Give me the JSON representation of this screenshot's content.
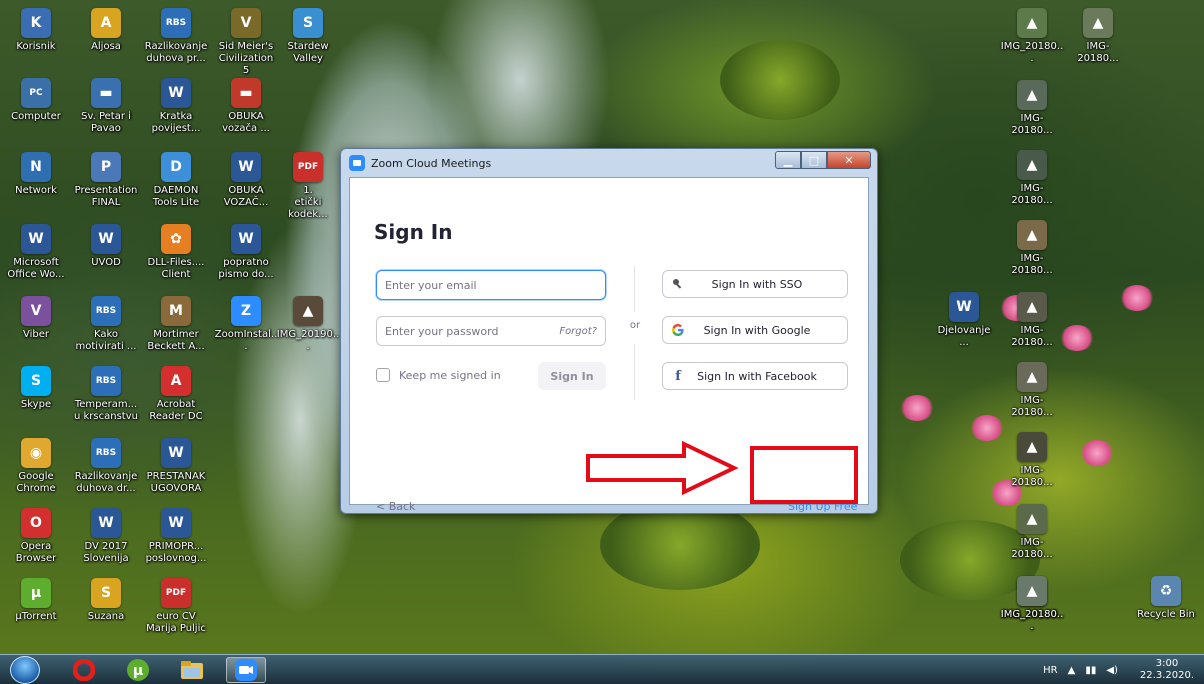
{
  "desktop": {
    "icons_left": [
      {
        "label": "Korisnik",
        "glyph": "K",
        "color": "#3b6db3"
      },
      {
        "label": "Aljosa",
        "glyph": "A",
        "color": "#d9a521"
      },
      {
        "label": "Razlikovanje\nduhova pr...",
        "glyph": "RBS",
        "color": "#2c6fb8"
      },
      {
        "label": "Sid Meier's\nCivilization 5",
        "glyph": "V",
        "color": "#7a6a2a"
      },
      {
        "label": "Stardew\nValley",
        "glyph": "S",
        "color": "#3a8fd0"
      },
      {
        "label": "Computer",
        "glyph": "PC",
        "color": "#3a6fa8"
      },
      {
        "label": "Sv. Petar i\nPavao",
        "glyph": "▬",
        "color": "#3a70b0"
      },
      {
        "label": "Kratka\npovijest...",
        "glyph": "W",
        "color": "#2b5797"
      },
      {
        "label": "OBUKA\nvozača ...",
        "glyph": "▬",
        "color": "#c0392b"
      },
      {
        "label": "Network",
        "glyph": "N",
        "color": "#2f6fb0"
      },
      {
        "label": "Presentation\nFINAL",
        "glyph": "P",
        "color": "#4a78b8"
      },
      {
        "label": "DAEMON\nTools Lite",
        "glyph": "D",
        "color": "#3c8fd8"
      },
      {
        "label": "OBUKA\nVOZAČ...",
        "glyph": "W",
        "color": "#2b5797"
      },
      {
        "label": "1.\netički kodek...",
        "glyph": "PDF",
        "color": "#c9302c"
      },
      {
        "label": "Microsoft\nOffice Wo...",
        "glyph": "W",
        "color": "#2b5797"
      },
      {
        "label": "UVOD",
        "glyph": "W",
        "color": "#2b5797"
      },
      {
        "label": "DLL-Files....\nClient",
        "glyph": "✿",
        "color": "#e67e22"
      },
      {
        "label": "popratno\npismo do...",
        "glyph": "W",
        "color": "#2b5797"
      },
      {
        "label": "Viber",
        "glyph": "V",
        "color": "#7b519d"
      },
      {
        "label": "Kako\nmotivirati ...",
        "glyph": "RBS",
        "color": "#2c6fb8"
      },
      {
        "label": "Mortimer\nBeckett A...",
        "glyph": "M",
        "color": "#8a6a3a"
      },
      {
        "label": "ZoomInstal...",
        "glyph": "Z",
        "color": "#2d8cff"
      },
      {
        "label": "IMG_20190...",
        "glyph": "▲",
        "color": "#5a4a3a"
      },
      {
        "label": "Skype",
        "glyph": "S",
        "color": "#00aff0"
      },
      {
        "label": "Temperam...\nu krscanstvu",
        "glyph": "RBS",
        "color": "#2c6fb8"
      },
      {
        "label": "Acrobat\nReader DC",
        "glyph": "A",
        "color": "#d32f2f"
      },
      {
        "label": "Google\nChrome",
        "glyph": "◉",
        "color": "#e0a82e"
      },
      {
        "label": "Razlikovanje\nduhova dr...",
        "glyph": "RBS",
        "color": "#2c6fb8"
      },
      {
        "label": "PRESTANAK\nUGOVORA",
        "glyph": "W",
        "color": "#2b5797"
      },
      {
        "label": "Opera\nBrowser",
        "glyph": "O",
        "color": "#d32f2f"
      },
      {
        "label": "DV 2017\nSlovenija",
        "glyph": "W",
        "color": "#2b5797"
      },
      {
        "label": "PRIMOPR...\nposlovnog...",
        "glyph": "W",
        "color": "#2b5797"
      },
      {
        "label": "µTorrent",
        "glyph": "µ",
        "color": "#5fad2e"
      },
      {
        "label": "Suzana",
        "glyph": "S",
        "color": "#d9a521"
      },
      {
        "label": "euro CV\nMarija Puljic",
        "glyph": "PDF",
        "color": "#c9302c"
      }
    ],
    "icons_right": [
      {
        "label": "IMG_20180...",
        "glyph": "▲",
        "color": "#5d7a4a"
      },
      {
        "label": "IMG-20180...",
        "glyph": "▲",
        "color": "#6a7a5a"
      },
      {
        "label": "IMG-20180...",
        "glyph": "▲",
        "color": "#5a6a5a"
      },
      {
        "label": "IMG-20180...",
        "glyph": "▲",
        "color": "#4a5a4a"
      },
      {
        "label": "IMG-20180...",
        "glyph": "▲",
        "color": "#7a6a4a"
      },
      {
        "label": "Djelovanje ...",
        "glyph": "W",
        "color": "#2b5797"
      },
      {
        "label": "IMG-20180...",
        "glyph": "▲",
        "color": "#5a5a4a"
      },
      {
        "label": "IMG-20180...",
        "glyph": "▲",
        "color": "#6a6a5a"
      },
      {
        "label": "IMG-20180...",
        "glyph": "▲",
        "color": "#4a4a3a"
      },
      {
        "label": "IMG-20180...",
        "glyph": "▲",
        "color": "#5a6a4a"
      },
      {
        "label": "IMG_20180...",
        "glyph": "▲",
        "color": "#5a7a6a"
      },
      {
        "label": "IMG_20180...",
        "glyph": "▲",
        "color": "#6a7a6a"
      },
      {
        "label": "Recycle Bin",
        "glyph": "♻",
        "color": "#5a86b0"
      }
    ]
  },
  "window": {
    "title": "Zoom Cloud Meetings",
    "heading": "Sign In",
    "email_placeholder": "Enter your email",
    "password_placeholder": "Enter your password",
    "forgot_label": "Forgot?",
    "keep_signed_in_label": "Keep me signed in",
    "sign_in_button": "Sign In",
    "or_label": "or",
    "sso_label": "Sign In with SSO",
    "google_label": "Sign In with Google",
    "facebook_label": "Sign In with Facebook",
    "back_label": "< Back",
    "signup_label": "Sign Up Free",
    "minimize_glyph": "▁",
    "maximize_glyph": "□",
    "close_glyph": "✕",
    "accent": "#2d8cff"
  },
  "annotation": {
    "color": "#e30b18"
  },
  "taskbar": {
    "language": "HR",
    "time": "3:00",
    "date": "22.3.2020.",
    "tray_arrow": "▲",
    "items": [
      "windows-start",
      "opera",
      "utorrent",
      "file-explorer",
      "zoom"
    ]
  }
}
